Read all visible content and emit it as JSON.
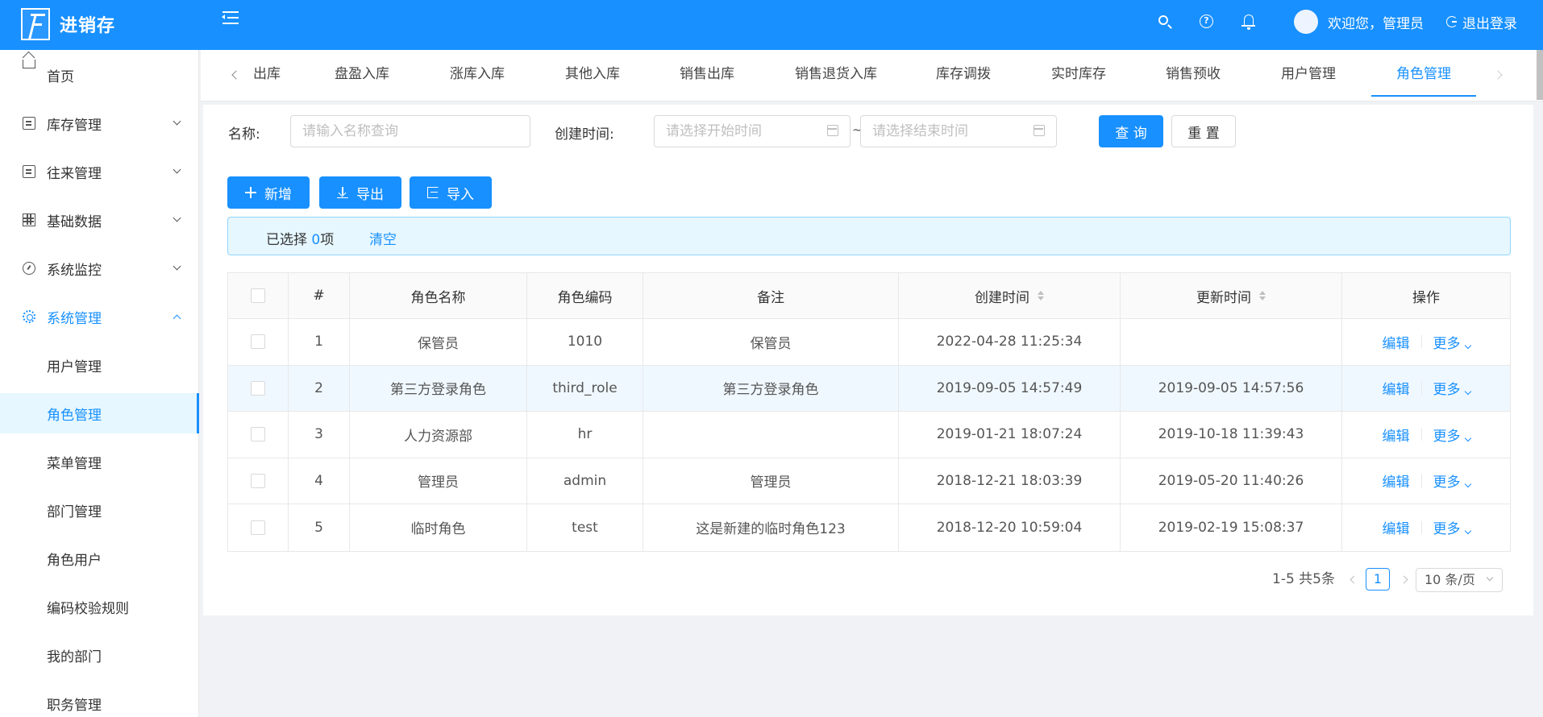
{
  "app": {
    "title": "进销存"
  },
  "header": {
    "welcome": "欢迎您，管理员",
    "logout": "退出登录"
  },
  "sidebar": {
    "items": [
      {
        "label": "首页",
        "icon": "home-icon"
      },
      {
        "label": "库存管理",
        "icon": "document-icon"
      },
      {
        "label": "往来管理",
        "icon": "ledger-icon"
      },
      {
        "label": "基础数据",
        "icon": "table-icon"
      },
      {
        "label": "系统监控",
        "icon": "dashboard-icon"
      },
      {
        "label": "系统管理",
        "icon": "gear-icon"
      }
    ],
    "sub_items": [
      {
        "label": "用户管理"
      },
      {
        "label": "角色管理"
      },
      {
        "label": "菜单管理"
      },
      {
        "label": "部门管理"
      },
      {
        "label": "角色用户"
      },
      {
        "label": "编码校验规则"
      },
      {
        "label": "我的部门"
      },
      {
        "label": "职务管理"
      }
    ]
  },
  "tabs": [
    {
      "label": "出库"
    },
    {
      "label": "盘盈入库"
    },
    {
      "label": "涨库入库"
    },
    {
      "label": "其他入库"
    },
    {
      "label": "销售出库"
    },
    {
      "label": "销售退货入库"
    },
    {
      "label": "库存调拨"
    },
    {
      "label": "实时库存"
    },
    {
      "label": "销售预收"
    },
    {
      "label": "用户管理"
    },
    {
      "label": "角色管理"
    }
  ],
  "filters": {
    "name_label": "名称:",
    "name_placeholder": "请输入名称查询",
    "time_label": "创建时间:",
    "start_placeholder": "请选择开始时间",
    "end_placeholder": "请选择结束时间",
    "separator": "~",
    "query": "查 询",
    "reset": "重 置"
  },
  "toolbar": {
    "add": "新增",
    "export": "导出",
    "import": "导入"
  },
  "selection": {
    "prefix": "已选择 ",
    "count": "0",
    "suffix": "项",
    "clear": "清空"
  },
  "table": {
    "columns": [
      "#",
      "角色名称",
      "角色编码",
      "备注",
      "创建时间",
      "更新时间",
      "操作"
    ],
    "rows": [
      {
        "idx": "1",
        "name": "保管员",
        "code": "1010",
        "remark": "保管员",
        "created": "2022-04-28 11:25:34",
        "updated": ""
      },
      {
        "idx": "2",
        "name": "第三方登录角色",
        "code": "third_role",
        "remark": "第三方登录角色",
        "created": "2019-09-05 14:57:49",
        "updated": "2019-09-05 14:57:56"
      },
      {
        "idx": "3",
        "name": "人力资源部",
        "code": "hr",
        "remark": "",
        "created": "2019-01-21 18:07:24",
        "updated": "2019-10-18 11:39:43"
      },
      {
        "idx": "4",
        "name": "管理员",
        "code": "admin",
        "remark": "管理员",
        "created": "2018-12-21 18:03:39",
        "updated": "2019-05-20 11:40:26"
      },
      {
        "idx": "5",
        "name": "临时角色",
        "code": "test",
        "remark": "这是新建的临时角色123",
        "created": "2018-12-20 10:59:04",
        "updated": "2019-02-19 15:08:37"
      }
    ],
    "edit": "编辑",
    "more": "更多"
  },
  "pagination": {
    "summary": "1-5 共5条",
    "current": "1",
    "page_size": "10 条/页"
  }
}
